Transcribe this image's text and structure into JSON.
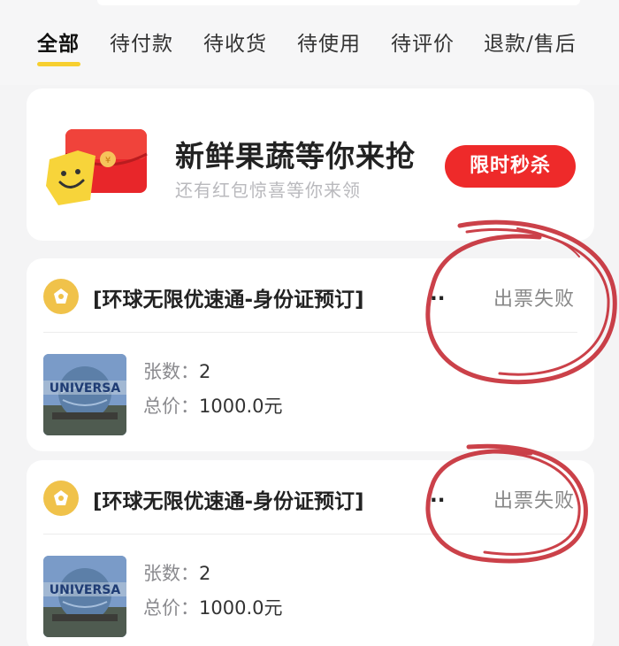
{
  "tabs": [
    {
      "label": "全部",
      "active": true
    },
    {
      "label": "待付款"
    },
    {
      "label": "待收货"
    },
    {
      "label": "待使用"
    },
    {
      "label": "待评价"
    },
    {
      "label": "退款/售后"
    }
  ],
  "promo": {
    "title": "新鲜果蔬等你来抢",
    "subtitle": "还有红包惊喜等你来领",
    "button": "限时秒杀"
  },
  "orders": [
    {
      "title": "[环球无限优速通-身份证预订]",
      "ellipsis": "..",
      "status": "出票失败",
      "thumb_text": "UNIVERSA",
      "qty_label": "张数：",
      "qty": "2",
      "price_label": "总价：",
      "price": "1000.0元"
    },
    {
      "title": "[环球无限优速通-身份证预订]",
      "ellipsis": "..",
      "status": "出票失败",
      "thumb_text": "UNIVERSA",
      "qty_label": "张数：",
      "qty": "2",
      "price_label": "总价：",
      "price": "1000.0元"
    }
  ],
  "colors": {
    "accent_yellow": "#f7cf2f",
    "flash_red": "#ee2a2a",
    "marker_red": "#c2202a"
  }
}
